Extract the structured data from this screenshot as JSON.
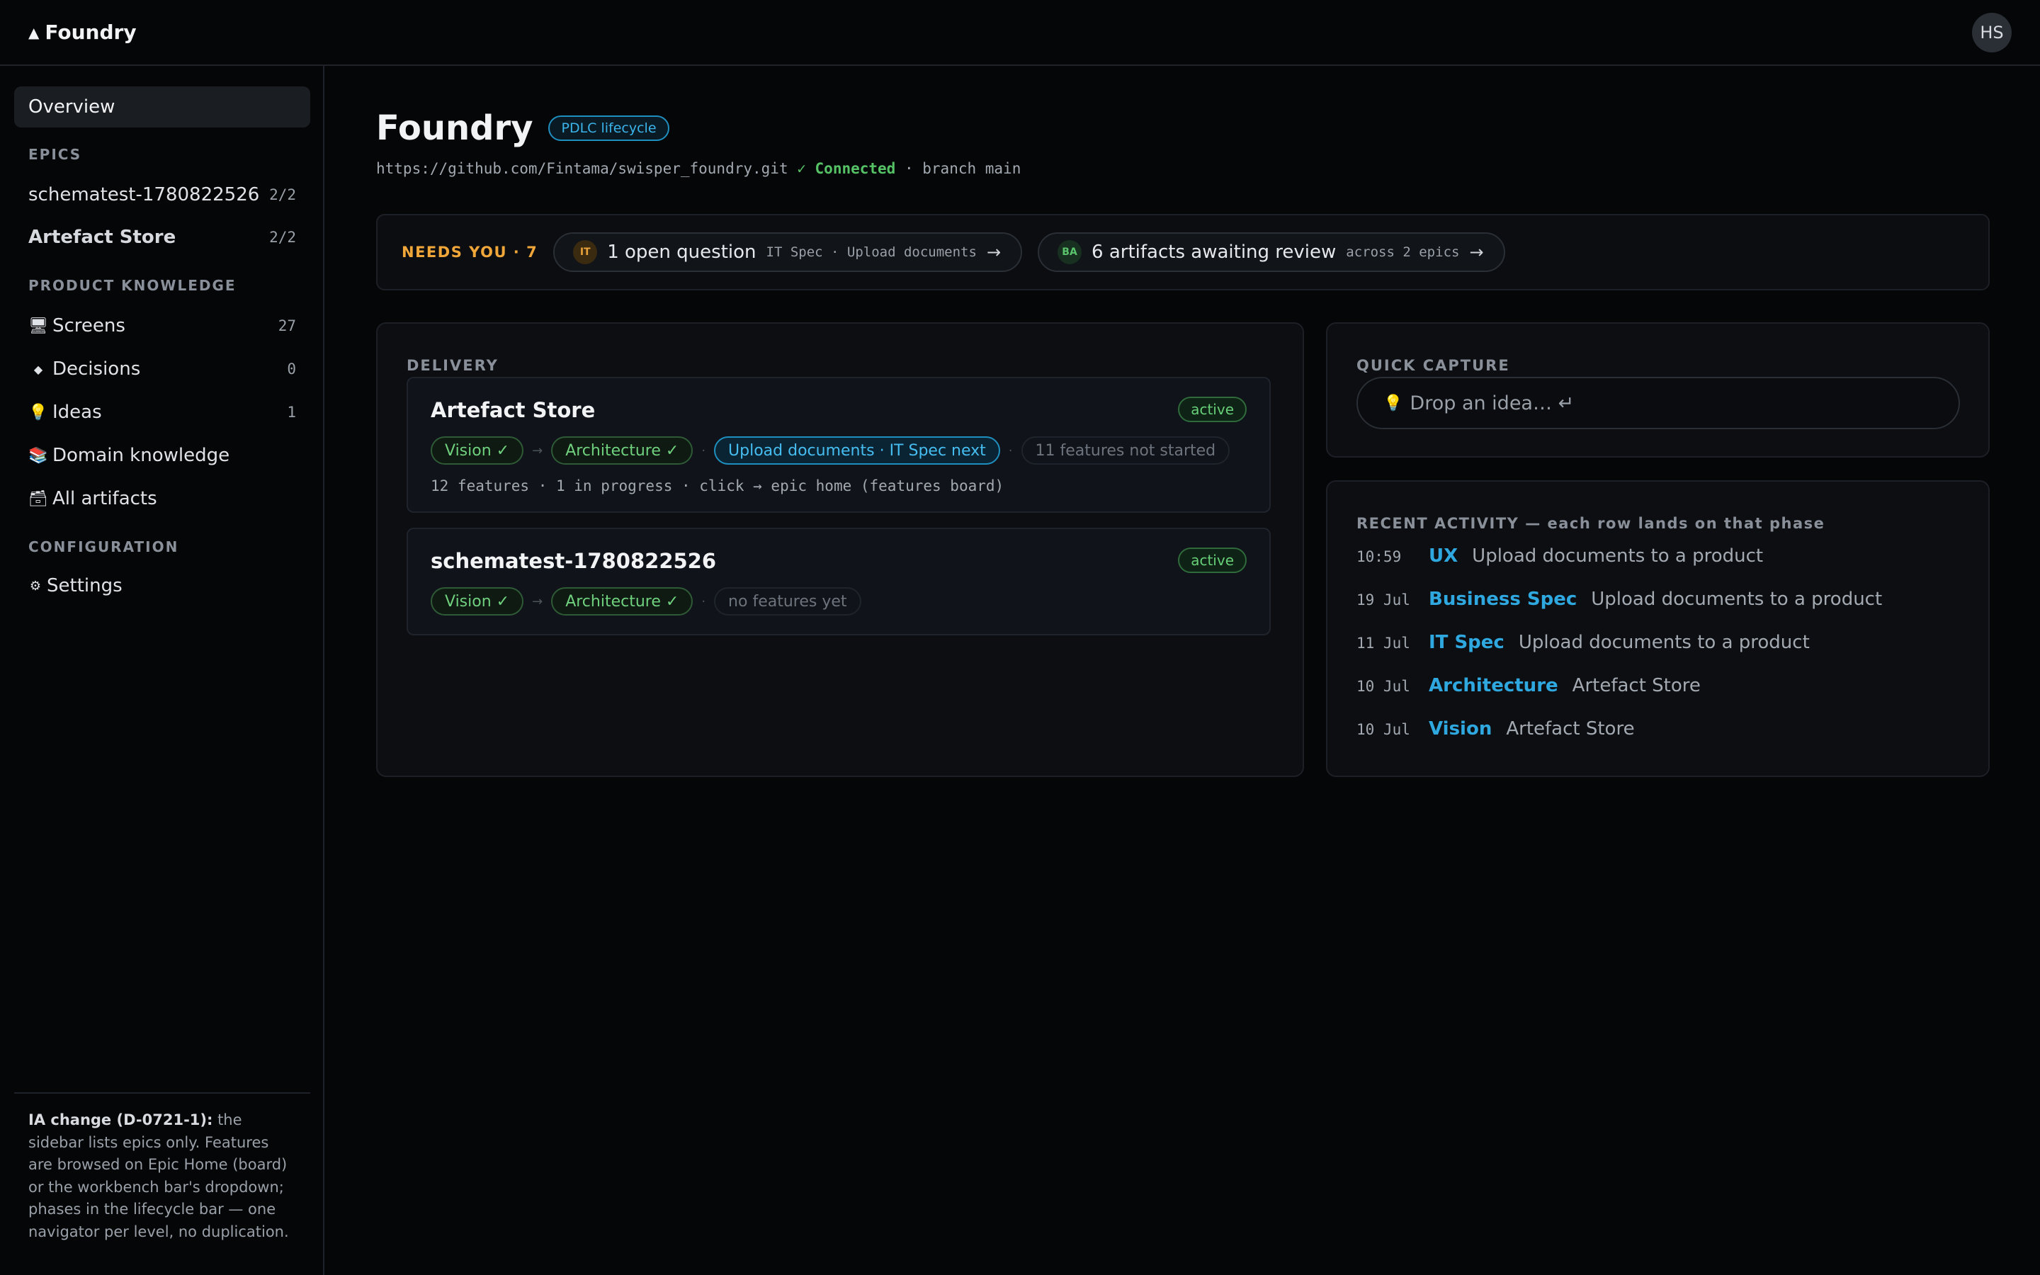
{
  "app": {
    "brand": "Foundry",
    "brand_icon": "triangle-icon",
    "user_initials": "HS"
  },
  "sidebar": {
    "overview_label": "Overview",
    "sections": {
      "epics": "EPICS",
      "product_knowledge": "PRODUCT KNOWLEDGE",
      "configuration": "CONFIGURATION"
    },
    "epics": [
      {
        "label": "schematest-1780822526",
        "count": "2/2"
      },
      {
        "label": "Artefact Store",
        "count": "2/2"
      }
    ],
    "knowledge": [
      {
        "icon": "🖥",
        "label": "Screens",
        "count": "27"
      },
      {
        "icon": "◆",
        "label": "Decisions",
        "count": "0"
      },
      {
        "icon": "💡",
        "label": "Ideas",
        "count": "1"
      },
      {
        "icon": "📚",
        "label": "Domain knowledge",
        "count": ""
      },
      {
        "icon": "🗃",
        "label": "All artifacts",
        "count": ""
      }
    ],
    "settings": {
      "icon": "⚙",
      "label": "Settings"
    },
    "note": {
      "title": "IA change (D-0721-1):",
      "body": " the sidebar lists epics only. Features are browsed on Epic Home (board) or the workbench bar's dropdown; phases in the lifecycle bar — one navigator per level, no duplication."
    }
  },
  "header": {
    "title": "Foundry",
    "badge": "PDLC lifecycle",
    "repo_url": "https://github.com/Fintama/swisper_foundry.git",
    "connection": "✓ Connected",
    "branch": "· branch main"
  },
  "needs_you": {
    "label": "NEEDS YOU · 7",
    "items": [
      {
        "badge": "IT",
        "text": "1 open question",
        "sub": "IT Spec · Upload documents",
        "arrow": "→"
      },
      {
        "badge": "BA",
        "text": "6 artifacts awaiting review",
        "sub": "across 2 epics",
        "arrow": "→"
      }
    ]
  },
  "delivery": {
    "label": "DELIVERY",
    "epics": [
      {
        "title": "Artefact Store",
        "status": "active",
        "phases": {
          "p1": "Vision ✓",
          "p2": "Architecture ✓",
          "p3": "Upload documents · IT Spec next",
          "p4": "11 features not started"
        },
        "meta": "12 features · 1 in progress · click → epic home (features board)"
      },
      {
        "title": "schematest-1780822526",
        "status": "active",
        "phases": {
          "p1": "Vision ✓",
          "p2": "Architecture ✓",
          "p3": "no features yet"
        }
      }
    ]
  },
  "quick_capture": {
    "label": "QUICK CAPTURE",
    "placeholder": "Drop an idea… ↵",
    "icon": "💡"
  },
  "activity": {
    "label": "RECENT ACTIVITY — each row lands on that phase",
    "rows": [
      {
        "time": "10:59",
        "phase": "UX",
        "desc": "Upload documents to a product"
      },
      {
        "time": "19 Jul",
        "phase": "Business Spec",
        "desc": "Upload documents to a product"
      },
      {
        "time": "11 Jul",
        "phase": "IT Spec",
        "desc": "Upload documents to a product"
      },
      {
        "time": "10 Jul",
        "phase": "Architecture",
        "desc": "Artefact Store"
      },
      {
        "time": "10 Jul",
        "phase": "Vision",
        "desc": "Artefact Store"
      }
    ]
  },
  "colors": {
    "accent": "#2fa8e0",
    "warning": "#f1a63a",
    "success": "#66cf77",
    "background": "#050608"
  }
}
